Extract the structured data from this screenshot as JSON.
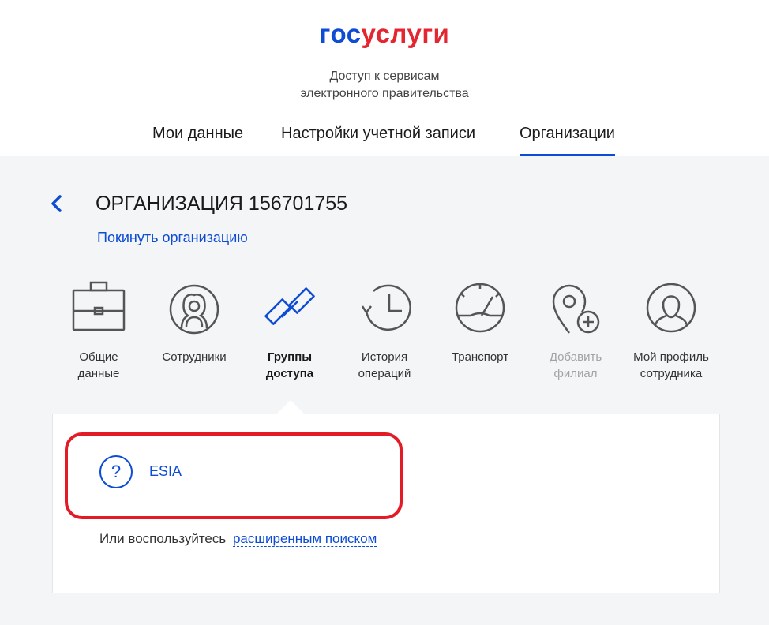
{
  "header": {
    "logo_part1": "гос",
    "logo_part2": "услуги",
    "tagline_line1": "Доступ к сервисам",
    "tagline_line2": "электронного правительства"
  },
  "nav": {
    "items": [
      {
        "label": "Мои данные"
      },
      {
        "label": "Настройки учетной записи"
      },
      {
        "label": "Организации"
      }
    ],
    "active": "Организации"
  },
  "org": {
    "title": "ОРГАНИЗАЦИЯ 156701755",
    "leave_link": "Покинуть организацию"
  },
  "tiles": [
    {
      "label": "Общие\nданные",
      "icon": "briefcase-icon"
    },
    {
      "label": "Сотрудники",
      "icon": "employees-icon"
    },
    {
      "label": "Группы\nдоступа",
      "icon": "chain-link-icon"
    },
    {
      "label": "История\nопераций",
      "icon": "history-icon"
    },
    {
      "label": "Транспорт",
      "icon": "speedometer-icon"
    },
    {
      "label": "Добавить\nфилиал",
      "icon": "add-location-icon"
    },
    {
      "label": "Мой профиль\nсотрудника",
      "icon": "profile-icon"
    }
  ],
  "groups": {
    "items": [
      {
        "label": "ESIA"
      }
    ],
    "help_symbol": "?",
    "search_prefix": "Или воспользуйтесь",
    "search_link": "расширенным поиском"
  },
  "colors": {
    "brand_blue": "#0d4cd3",
    "brand_red": "#e3262f",
    "highlight_red": "#e21b26",
    "gray_bg": "#f3f5f6",
    "icon_gray": "#555555",
    "disabled_gray": "#a3a3a3"
  }
}
